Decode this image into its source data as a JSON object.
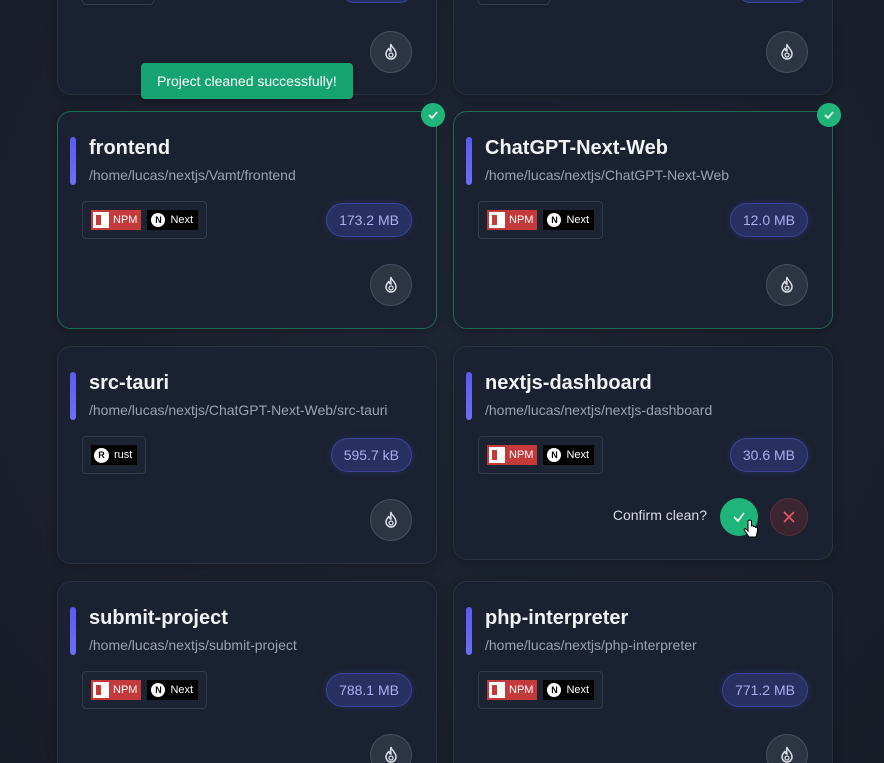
{
  "toast": {
    "message": "Project cleaned successfully!"
  },
  "confirm": {
    "prompt": "Confirm clean?"
  },
  "badge_labels": {
    "npm": "NPM",
    "next": "Next",
    "rust": "rust"
  },
  "colors": {
    "accent": "#5a5cf0",
    "success": "#1fb57a",
    "size_pill": "#283061",
    "danger": "#5b2f3a"
  },
  "icons": {
    "clean": "flame-icon",
    "cleaned": "check-icon",
    "confirm": "check-icon",
    "cancel": "close-icon"
  },
  "projects": [
    {
      "name": "frontend",
      "path": "/home/lucas/nextjs/Vamt/frontend",
      "size": "173.2 MB",
      "tags": [
        "npm",
        "next"
      ],
      "cleaned": true
    },
    {
      "name": "ChatGPT-Next-Web",
      "path": "/home/lucas/nextjs/ChatGPT-Next-Web",
      "size": "12.0 MB",
      "tags": [
        "npm",
        "next"
      ],
      "cleaned": true
    },
    {
      "name": "src-tauri",
      "path": "/home/lucas/nextjs/ChatGPT-Next-Web/src-tauri",
      "size": "595.7 kB",
      "tags": [
        "rust"
      ],
      "cleaned": false
    },
    {
      "name": "nextjs-dashboard",
      "path": "/home/lucas/nextjs/nextjs-dashboard",
      "size": "30.6 MB",
      "tags": [
        "npm",
        "next"
      ],
      "cleaned": false,
      "confirming": true
    },
    {
      "name": "submit-project",
      "path": "/home/lucas/nextjs/submit-project",
      "size": "788.1 MB",
      "tags": [
        "npm",
        "next"
      ],
      "cleaned": false
    },
    {
      "name": "php-interpreter",
      "path": "/home/lucas/nextjs/php-interpreter",
      "size": "771.2 MB",
      "tags": [
        "npm",
        "next"
      ],
      "cleaned": false
    }
  ]
}
